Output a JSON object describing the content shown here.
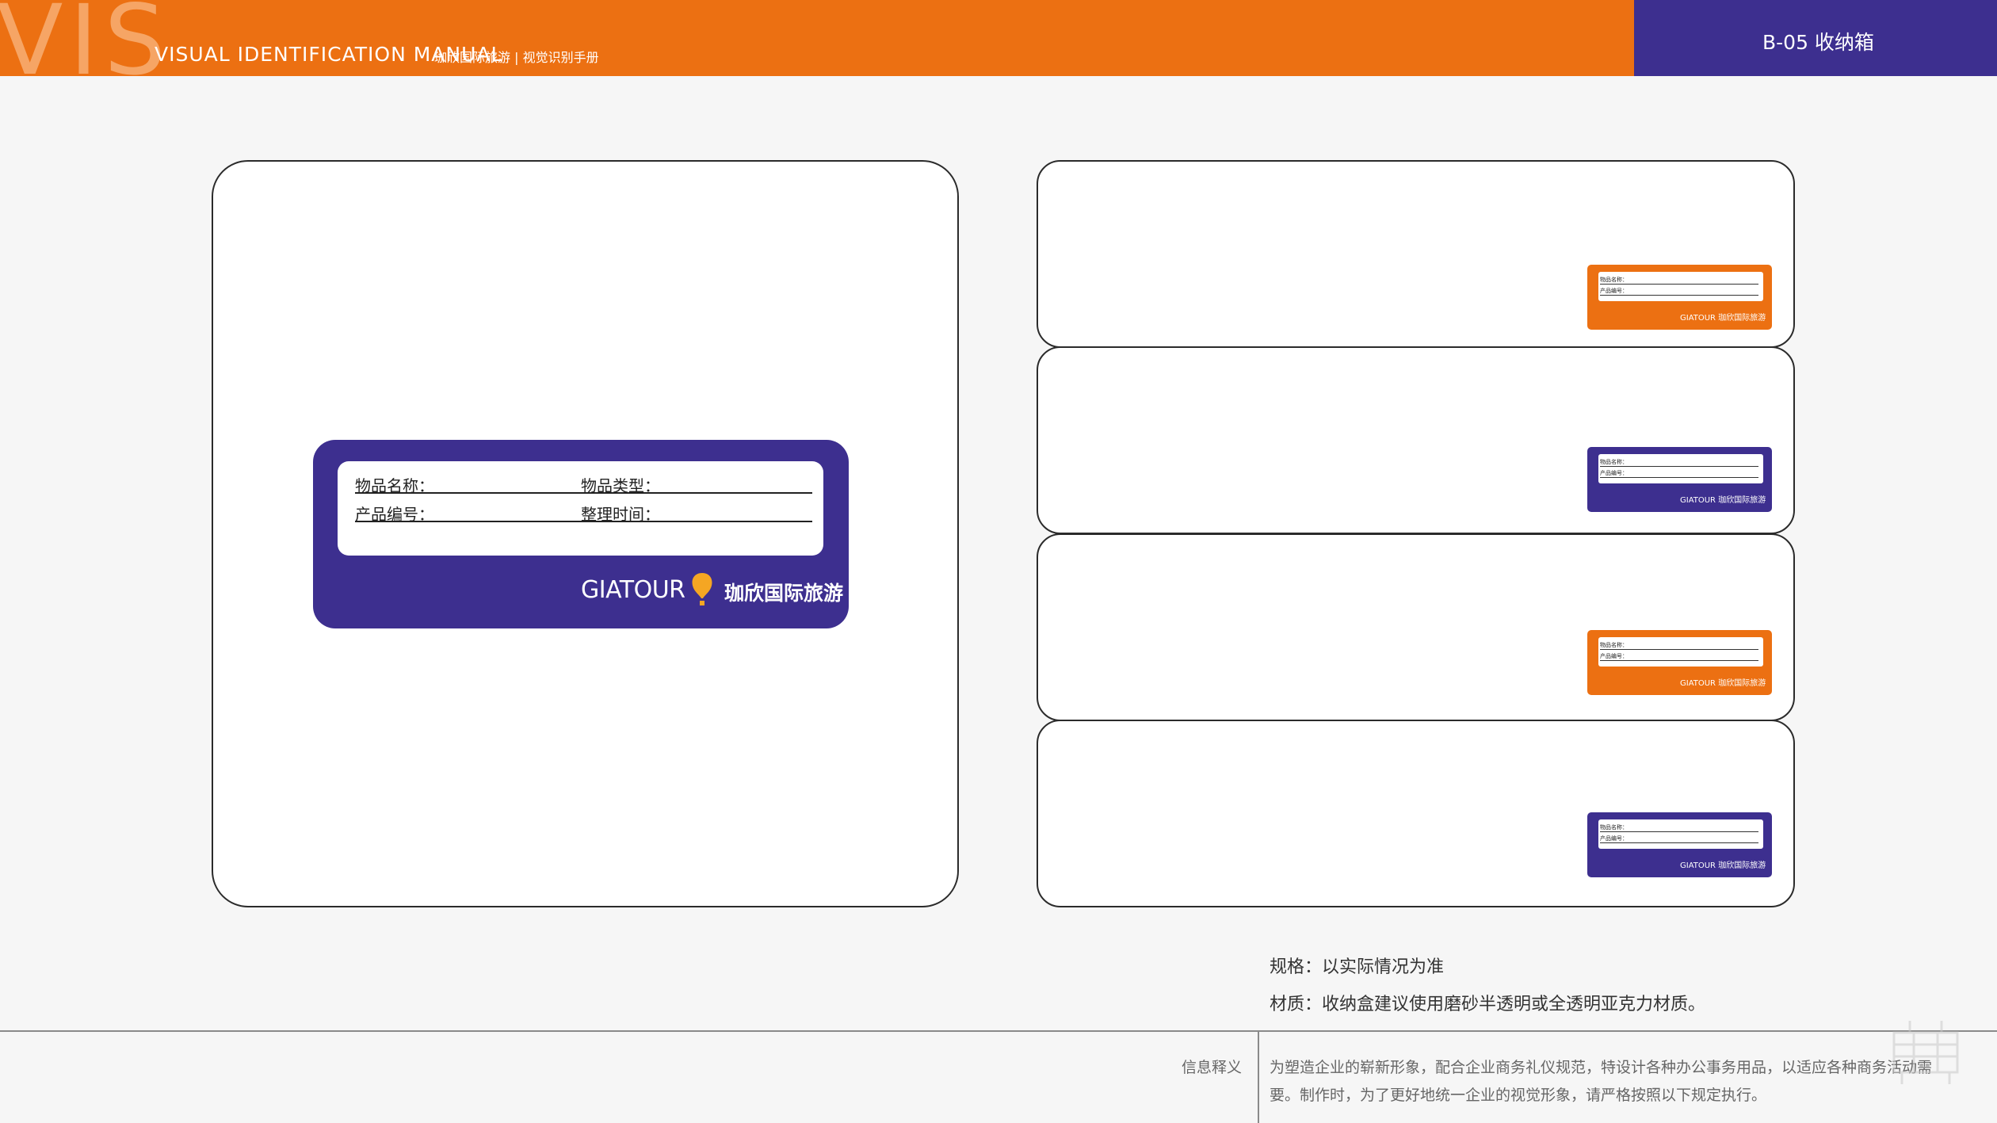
{
  "header": {
    "vis_mark": "VIS",
    "manual_title": "VISUAL IDENTIFICATION MANUAL",
    "manual_subtitle": "珈欣国际旅游 | 视觉识别手册",
    "page_code": "B-05 收纳箱"
  },
  "big_label": {
    "item_name": "物品名称：",
    "item_type": "物品类型：",
    "product_no": "产品编号：",
    "sort_time": "整理时间：",
    "brand_en": "GIATOUR",
    "brand_cn": "珈欣国际旅游"
  },
  "mini_labels": {
    "item_name": "物品名称：",
    "product_no": "产品编号：",
    "brand": "GIATOUR 珈欣国际旅游"
  },
  "specs": {
    "size": "规格：以实际情况为准",
    "material": "材质：收纳盒建议使用磨砂半透明或全透明亚克力材质。"
  },
  "footer": {
    "label": "信息释义",
    "line1": "为塑造企业的崭新形象，配合企业商务礼仪规范，特设计各种办公事务用品，以适应各种商务活动需",
    "line2": "要。制作时，为了更好地统一企业的视觉形象，请严格按照以下规定执行。"
  },
  "colors": {
    "orange": "#ec7012",
    "purple": "#3d2f8f",
    "balloon": "#f5a623"
  }
}
